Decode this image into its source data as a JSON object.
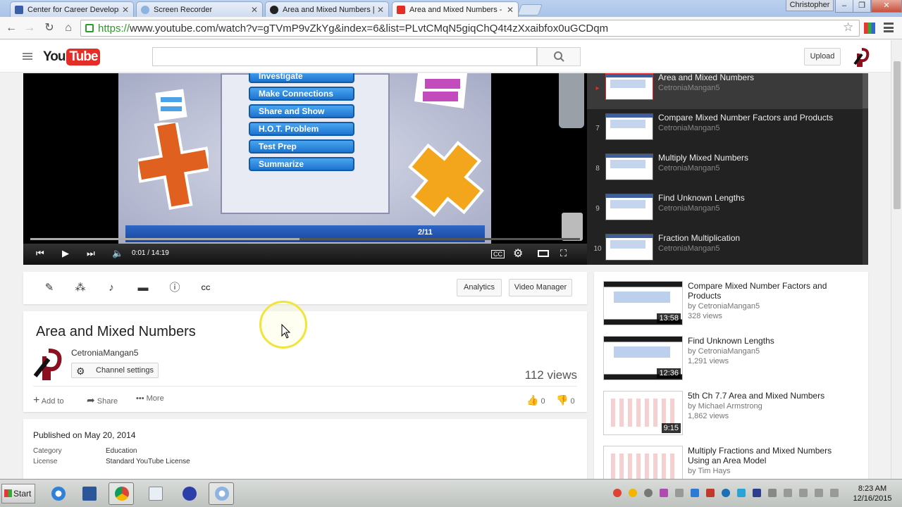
{
  "browser": {
    "tabs": [
      {
        "label": "Center for Career Developm",
        "favicon_color": "#3b5ea8",
        "active": false
      },
      {
        "label": "Screen Recorder",
        "favicon_color": "#8fb3e0",
        "active": false
      },
      {
        "label": "Area and Mixed Numbers | Sc",
        "favicon_color": "#222222",
        "active": false
      },
      {
        "label": "Area and Mixed Numbers - Yo",
        "favicon_color": "#e52d27",
        "active": true
      }
    ],
    "user": "Christopher",
    "window_controls": {
      "minimize": "–",
      "restore": "❐",
      "close": "✕"
    },
    "url_https": "https://",
    "url_rest": "www.youtube.com/watch?v=gTVmP9vZkYg&index=6&list=PLvtCMqN5giqChQ4t4zXxaibfox0uGCDqm"
  },
  "youtube": {
    "logo_you": "You",
    "logo_tube": "Tube",
    "upload": "Upload"
  },
  "player": {
    "menu_items": [
      "Investigate",
      "Make Connections",
      "Share and Show",
      "H.O.T. Problem",
      "Test Prep",
      "Summarize"
    ],
    "slide_counter": "2/11",
    "timecode": "0:01 / 14:19",
    "buffered_fraction": 0.49
  },
  "playlist": {
    "items": [
      {
        "index": "▸",
        "title": "Area and Mixed Numbers",
        "channel": "CetroniaMangan5",
        "current": true
      },
      {
        "index": "7",
        "title": "Compare Mixed Number Factors and Products",
        "channel": "CetroniaMangan5",
        "current": false
      },
      {
        "index": "8",
        "title": "Multiply Mixed Numbers",
        "channel": "CetroniaMangan5",
        "current": false
      },
      {
        "index": "9",
        "title": "Find Unknown Lengths",
        "channel": "CetroniaMangan5",
        "current": false
      },
      {
        "index": "10",
        "title": "Fraction Multiplication",
        "channel": "CetroniaMangan5",
        "current": false
      }
    ]
  },
  "action_bar": {
    "analytics": "Analytics",
    "video_manager": "Video Manager"
  },
  "video": {
    "title": "Area and Mixed Numbers",
    "channel": "CetroniaMangan5",
    "channel_settings": "Channel settings",
    "views": "112 views",
    "add_to": "Add to",
    "share": "Share",
    "more": "More",
    "likes": "0",
    "dislikes": "0"
  },
  "description": {
    "published": "Published on May 20, 2014",
    "category_label": "Category",
    "category_value": "Education",
    "license_label": "License",
    "license_value": "Standard YouTube License"
  },
  "related": [
    {
      "title": "Compare Mixed Number Factors and Products",
      "by": "by CetroniaMangan5",
      "views": "328 views",
      "duration": "13:58",
      "thumb": "video"
    },
    {
      "title": "Find Unknown Lengths",
      "by": "by CetroniaMangan5",
      "views": "1,291 views",
      "duration": "12:36",
      "thumb": "video"
    },
    {
      "title": "5th Ch 7.7 Area and Mixed Numbers",
      "by": "by Michael Armstrong",
      "views": "1,862 views",
      "duration": "9:15",
      "thumb": "sketch"
    },
    {
      "title": "Multiply Fractions and Mixed Numbers Using an Area Model",
      "by": "by Tim Hays",
      "views": "",
      "duration": "",
      "thumb": "sketch"
    }
  ],
  "taskbar": {
    "start": "Start",
    "time": "8:23 AM",
    "date": "12/16/2015"
  }
}
